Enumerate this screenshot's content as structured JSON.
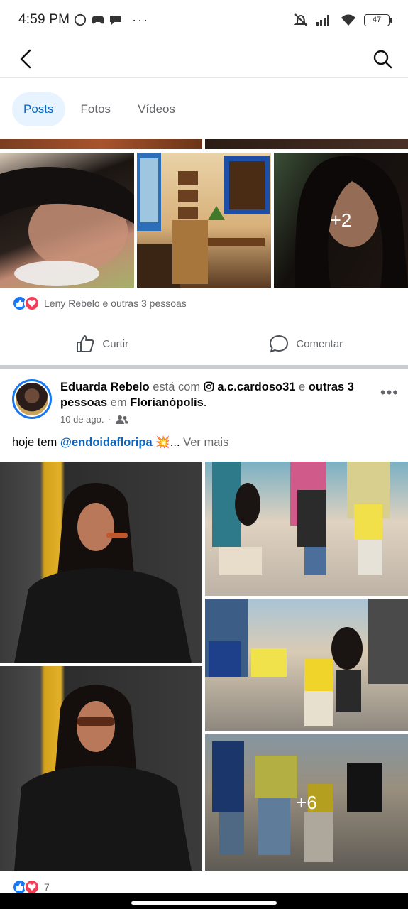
{
  "status_bar": {
    "time": "4:59 PM",
    "battery": "47",
    "icons": [
      "whatsapp-icon",
      "game-icon",
      "chat-icon",
      "more-icon",
      "mute-icon",
      "signal-icon",
      "wifi-icon",
      "battery-icon"
    ]
  },
  "nav": {
    "back_icon": "back-arrow-icon",
    "search_icon": "search-icon"
  },
  "tabs": [
    {
      "label": "Posts",
      "active": true
    },
    {
      "label": "Fotos",
      "active": false
    },
    {
      "label": "Vídeos",
      "active": false
    }
  ],
  "post1": {
    "more_photos": "+2",
    "reactions_text": "Leny Rebelo e outras 3 pessoas",
    "like_label": "Curtir",
    "comment_label": "Comentar"
  },
  "post2": {
    "author": "Eduarda Rebelo",
    "with_text": "está com",
    "tagged": "a.c.cardoso31",
    "and_text": "e",
    "others": "outras 3 pessoas",
    "in_text": "em",
    "location": "Florianópolis",
    "date": "10 de ago.",
    "caption_prefix": "hoje tem",
    "mention": "@endoidafloripa",
    "caption_ellipsis": "💥...",
    "see_more": "Ver mais",
    "more_photos": "+6",
    "reaction_count": "7"
  },
  "colors": {
    "accent": "#0a66c2",
    "like_blue": "#1877f2",
    "love_red": "#f33e58",
    "muted_text": "#65676b"
  }
}
